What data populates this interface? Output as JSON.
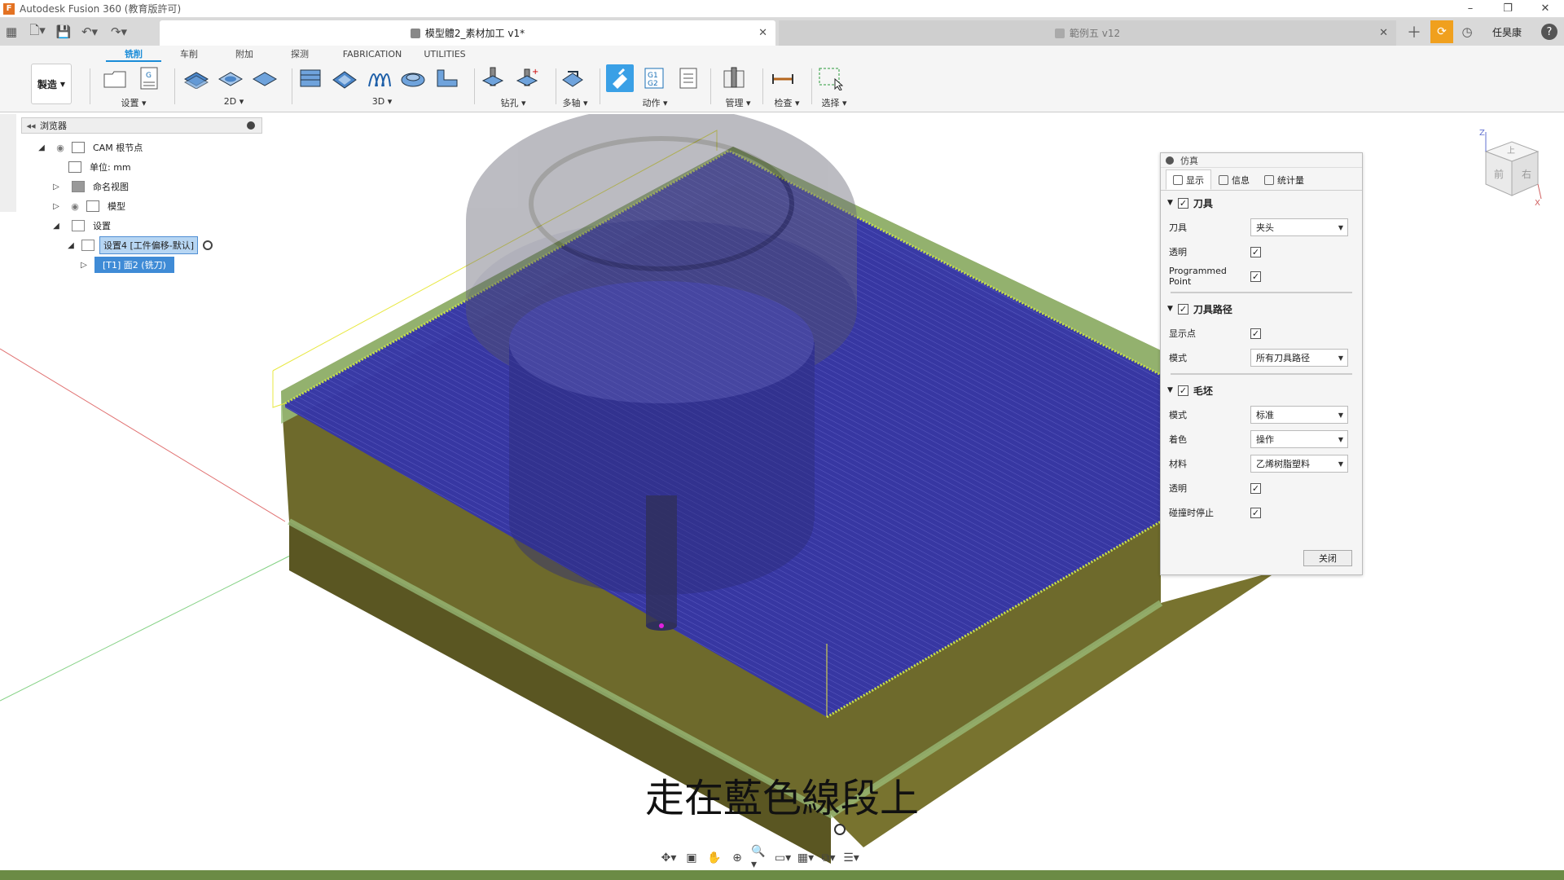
{
  "window": {
    "title": "Autodesk Fusion 360 (教育版許可)"
  },
  "tabs": {
    "active": "模型體2_素材加工 v1*",
    "inactive": "範例五 v12"
  },
  "user": {
    "name": "任昊康"
  },
  "workspace": {
    "button": "製造",
    "tabs": [
      "铣削",
      "车削",
      "附加",
      "探测",
      "FABRICATION",
      "UTILITIES"
    ]
  },
  "toolbar": {
    "groups": [
      "设置",
      "2D",
      "3D",
      "钻孔",
      "多轴",
      "动作",
      "管理",
      "检查",
      "选择"
    ]
  },
  "browser": {
    "title": "浏览器",
    "items": [
      "CAM 根节点",
      "单位: mm",
      "命名视图",
      "模型",
      "设置",
      "设置4 [工件偏移-默认]",
      "[T1] 面2 (铣刀)"
    ]
  },
  "simulation": {
    "title": "仿真",
    "tabs": [
      "显示",
      "信息",
      "统计量"
    ],
    "tool_section": "刀具",
    "tool_label": "刀具",
    "tool_value": "夹头",
    "transparent_label": "透明",
    "programmed_point_label": "Programmed Point",
    "toolpath_section": "刀具路径",
    "show_points_label": "显示点",
    "mode_label": "模式",
    "toolpath_mode_value": "所有刀具路径",
    "stock_section": "毛坯",
    "stock_mode_value": "标准",
    "color_label": "着色",
    "color_value": "操作",
    "material_label": "材料",
    "material_value": "乙烯树脂塑料",
    "stock_transparent_label": "透明",
    "stop_on_collision_label": "碰撞时停止",
    "close_label": "关闭"
  },
  "viewcube": {
    "faces": [
      "上",
      "前",
      "右"
    ],
    "axes": [
      "Z",
      "X"
    ]
  },
  "caption": "走在藍色線段上",
  "colors": {
    "accent": "#1a8cd8",
    "toolpath": "#2a2aa8",
    "stock": "#6e6a2c",
    "stock_edge": "#9cc37f"
  }
}
